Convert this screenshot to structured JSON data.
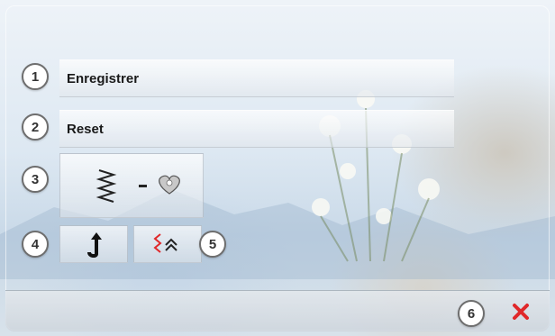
{
  "menu": {
    "items": [
      {
        "number": "1",
        "label": "Enregistrer"
      },
      {
        "number": "2",
        "label": "Reset"
      }
    ],
    "icon_buttons": [
      {
        "number": "3",
        "icons": [
          "zigzag-stitch-icon",
          "minus-icon",
          "heart-icon"
        ]
      },
      {
        "number": "4",
        "icons": [
          "needle-stop-icon"
        ]
      },
      {
        "number": "5",
        "icons": [
          "stitch-pattern-up-icon"
        ]
      }
    ]
  },
  "footer": {
    "number": "6",
    "close_icon": "close-icon"
  },
  "colors": {
    "close": "#e0282a",
    "number_border": "#6e6e6e"
  }
}
